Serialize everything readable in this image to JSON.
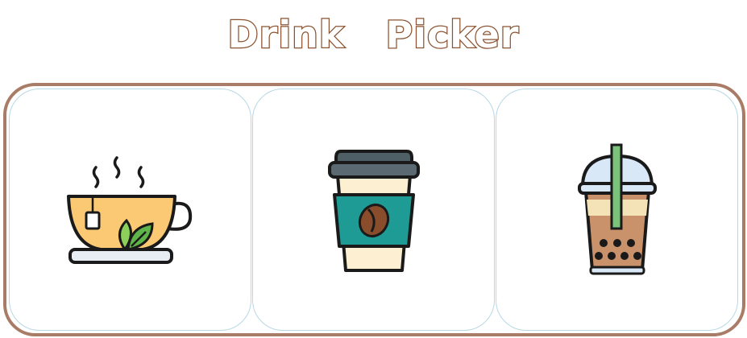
{
  "header": {
    "title": "Drink   Picker"
  },
  "options": [
    {
      "icon": "tea-cup-icon"
    },
    {
      "icon": "coffee-cup-icon"
    },
    {
      "icon": "bubble-tea-icon"
    }
  ],
  "colors": {
    "title_outline": "#8a5230",
    "frame_border": "#a87c66",
    "card_border": "#b7d8e4"
  }
}
